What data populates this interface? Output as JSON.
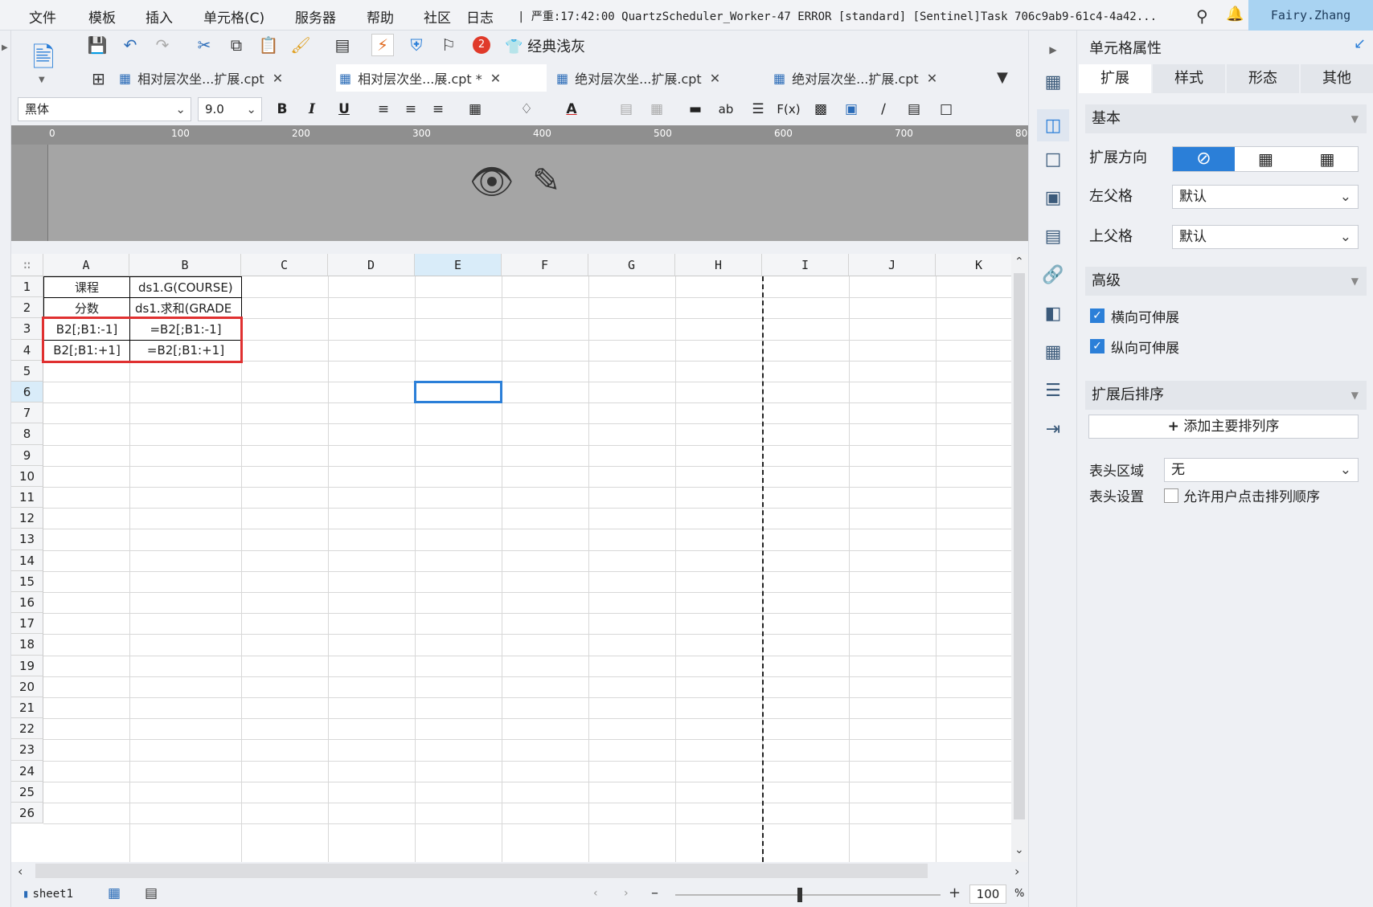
{
  "menubar": {
    "items": [
      "文件",
      "模板",
      "插入",
      "单元格(C)",
      "服务器",
      "帮助",
      "社区",
      "日志"
    ],
    "log_text": "| 严重:17:42:00 QuartzScheduler_Worker-47 ERROR [standard] [Sentinel]Task 706c9ab9-61c4-4a42...",
    "user": "Fairy.Zhang"
  },
  "toolbar": {
    "badge_count": "2",
    "theme_label": "经典浅灰"
  },
  "tabs": [
    {
      "label": "相对层次坐...扩展.cpt",
      "active": false
    },
    {
      "label": "相对层次坐...展.cpt *",
      "active": true
    },
    {
      "label": "绝对层次坐...扩展.cpt",
      "active": false
    },
    {
      "label": "绝对层次坐...扩展.cpt",
      "active": false
    }
  ],
  "format": {
    "font_name": "黑体",
    "font_size": "9.0"
  },
  "ruler": {
    "marks": [
      "0",
      "100",
      "200",
      "300",
      "400",
      "500",
      "600",
      "700",
      "80"
    ]
  },
  "grid": {
    "columns": [
      "A",
      "B",
      "C",
      "D",
      "E",
      "F",
      "G",
      "H",
      "I",
      "J",
      "K"
    ],
    "selected_column": "E",
    "rows": [
      "1",
      "2",
      "3",
      "4",
      "5",
      "6",
      "7",
      "8",
      "9",
      "10",
      "11",
      "12",
      "13",
      "14",
      "15",
      "16",
      "17",
      "18",
      "19",
      "20",
      "21",
      "22",
      "23",
      "24",
      "25",
      "26"
    ],
    "selected_row": "6",
    "cells": {
      "A1": "课程",
      "B1": "ds1.G(COURSE)",
      "A2": "分数",
      "B2": "ds1.求和(GRADE",
      "A3": "B2[;B1:-1]",
      "B3": "=B2[;B1:-1]",
      "A4": "B2[;B1:+1]",
      "B4": "=B2[;B1:+1]"
    }
  },
  "bottom": {
    "sheet_name": "sheet1",
    "zoom": "100",
    "zoom_unit": "%"
  },
  "props": {
    "title": "单元格属性",
    "tabs": [
      "扩展",
      "样式",
      "形态",
      "其他"
    ],
    "active_tab": "扩展",
    "basic_section": "基本",
    "expand_direction_label": "扩展方向",
    "left_parent_label": "左父格",
    "left_parent_value": "默认",
    "top_parent_label": "上父格",
    "top_parent_value": "默认",
    "advanced_section": "高级",
    "horizontal_expand": "横向可伸展",
    "vertical_expand": "纵向可伸展",
    "sort_section": "扩展后排序",
    "add_sort_label": "添加主要排列序",
    "header_area_label": "表头区域",
    "header_area_value": "无",
    "header_setting_label": "表头设置",
    "allow_click_sort": "允许用户点击排列顺序"
  },
  "colors": {
    "accent": "#2b7fd8",
    "highlight_red": "#e03030",
    "user_bg": "#a9d3f2"
  }
}
